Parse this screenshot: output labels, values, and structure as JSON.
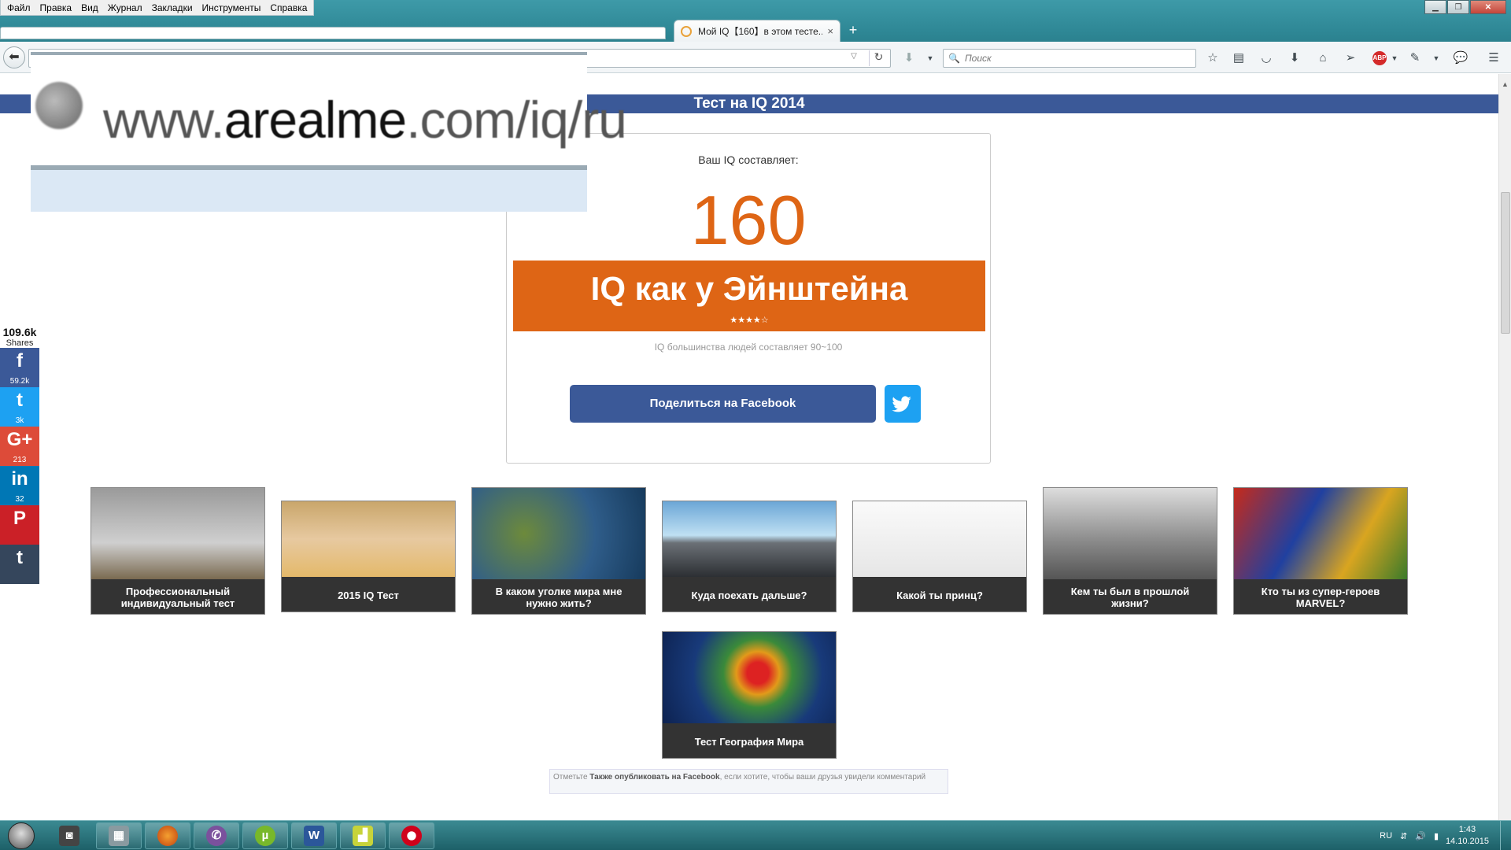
{
  "menu": [
    "Файл",
    "Правка",
    "Вид",
    "Журнал",
    "Закладки",
    "Инструменты",
    "Справка"
  ],
  "tab": {
    "title": "Мой IQ【160】в этом тесте...",
    "close": "×",
    "new": "+"
  },
  "search": {
    "placeholder": "Поиск"
  },
  "zoom_url": {
    "prefix": "www.",
    "domain": "arealme",
    "rest": ".com/iq/ru"
  },
  "page": {
    "header": "Тест на IQ 2014",
    "result_label": "Ваш IQ составляет:",
    "score": "160",
    "result_title": "IQ как у Эйнштейна",
    "stars": "★★★★☆",
    "average": "IQ большинства людей составляет 90~100",
    "fb_share": "Поделиться на Facebook"
  },
  "share": {
    "total": "109.6k",
    "total_label": "Shares",
    "items": [
      {
        "glyph": "f",
        "count": "59.2k",
        "color": "#3b5998"
      },
      {
        "glyph": "t",
        "count": "3k",
        "color": "#1da1f2"
      },
      {
        "glyph": "G+",
        "count": "213",
        "color": "#dd4b39"
      },
      {
        "glyph": "in",
        "count": "32",
        "color": "#0077b5"
      },
      {
        "glyph": "P",
        "count": "",
        "color": "#cb2027"
      },
      {
        "glyph": "t",
        "count": "",
        "color": "#35465c"
      }
    ]
  },
  "tiles": [
    "Профессиональный индивидуальный тест",
    "2015 IQ Тест",
    "В каком уголке мира мне нужно жить?",
    "Куда поехать дальше?",
    "Какой ты принц?",
    "Кем ты был в прошлой жизни?",
    "Кто ты из супер-героев MARVEL?",
    "Тест География Мира"
  ],
  "fbnote": {
    "pre": "Отметьте ",
    "bold": "Также опубликовать на Facebook",
    "post": ", если хотите, чтобы ваши друзья увидели комментарий"
  },
  "tray": {
    "lang": "RU",
    "time": "1:43",
    "date": "14.10.2015"
  },
  "colors": {
    "accent_orange": "#de6515",
    "facebook_blue": "#3b5998",
    "twitter": "#1da1f2"
  }
}
